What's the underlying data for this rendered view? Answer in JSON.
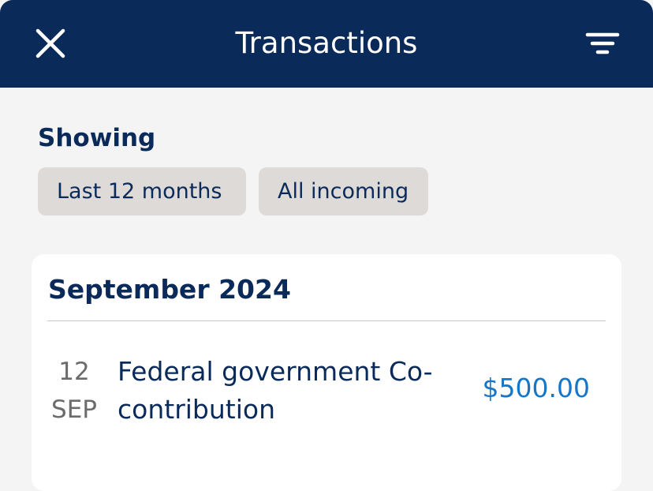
{
  "header": {
    "title": "Transactions",
    "close_icon": "close-icon",
    "filter_icon": "filter-icon"
  },
  "filters": {
    "label": "Showing",
    "chips": [
      "Last 12 months",
      "All incoming"
    ]
  },
  "sections": [
    {
      "month": "September 2024",
      "transactions": [
        {
          "day": "12",
          "month_abbr": "SEP",
          "description": "Federal government Co-contribution",
          "amount": "$500.00"
        }
      ]
    }
  ],
  "colors": {
    "header_bg": "#0a2a5a",
    "primary_text": "#0a2a5a",
    "amount_incoming": "#1676c8",
    "chip_bg": "#dedad8",
    "page_bg": "#f4f4f4"
  }
}
